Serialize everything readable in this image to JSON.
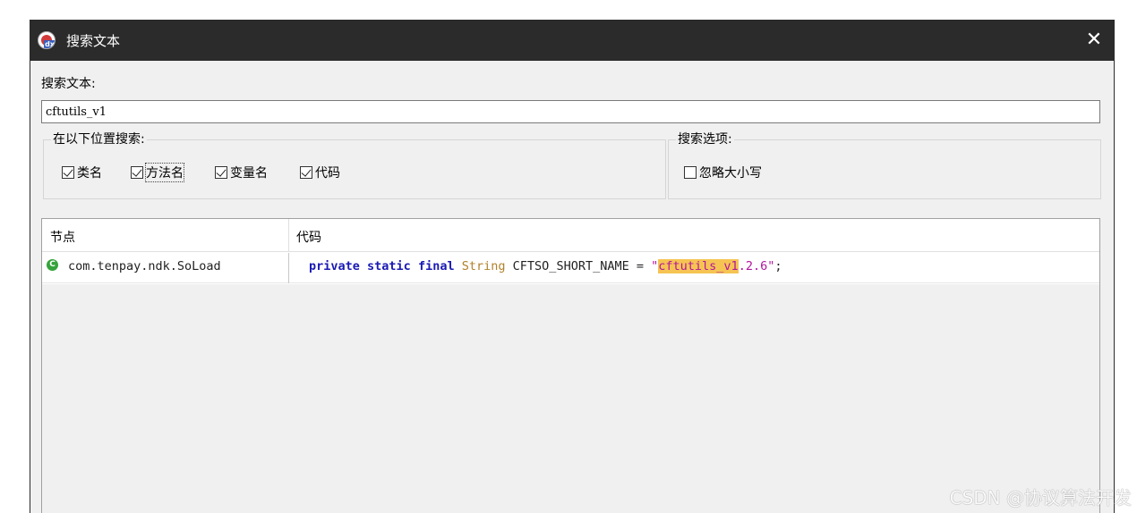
{
  "window": {
    "title": "搜索文本",
    "close_glyph": "✕",
    "app_icon": "jadx-app-icon",
    "app_icon_tag": "dx"
  },
  "search": {
    "label": "搜索文本:",
    "value": "cftutils_v1"
  },
  "scope_group": {
    "legend": "在以下位置搜索:",
    "options": [
      {
        "label": "类名",
        "checked": true
      },
      {
        "label": "方法名",
        "checked": true
      },
      {
        "label": "变量名",
        "checked": true
      },
      {
        "label": "代码",
        "checked": true
      }
    ]
  },
  "options_group": {
    "legend": "搜索选项:",
    "options": [
      {
        "label": "忽略大小写",
        "checked": false
      }
    ]
  },
  "results": {
    "columns": [
      "节点",
      "代码"
    ],
    "rows": [
      {
        "node_icon": "class-icon",
        "node_icon_glyph": "C",
        "node": "com.tenpay.ndk.SoLoad",
        "code": {
          "kw1": "private",
          "kw2": "static",
          "kw3": "final",
          "type": "String",
          "ident": "CFTSO_SHORT_NAME",
          "op": "=",
          "str_open": "\"",
          "str_match": "cftutils_v1",
          "str_rest": ".2.6\"",
          "end": ";"
        }
      }
    ]
  },
  "watermark": "CSDN @协议算法开发",
  "colors": {
    "titlebar": "#2b2b2b",
    "keyword": "#1a1ab4",
    "type": "#b0822b",
    "string": "#b1169e",
    "highlight": "#f6c452",
    "class_icon": "#35a33b"
  }
}
